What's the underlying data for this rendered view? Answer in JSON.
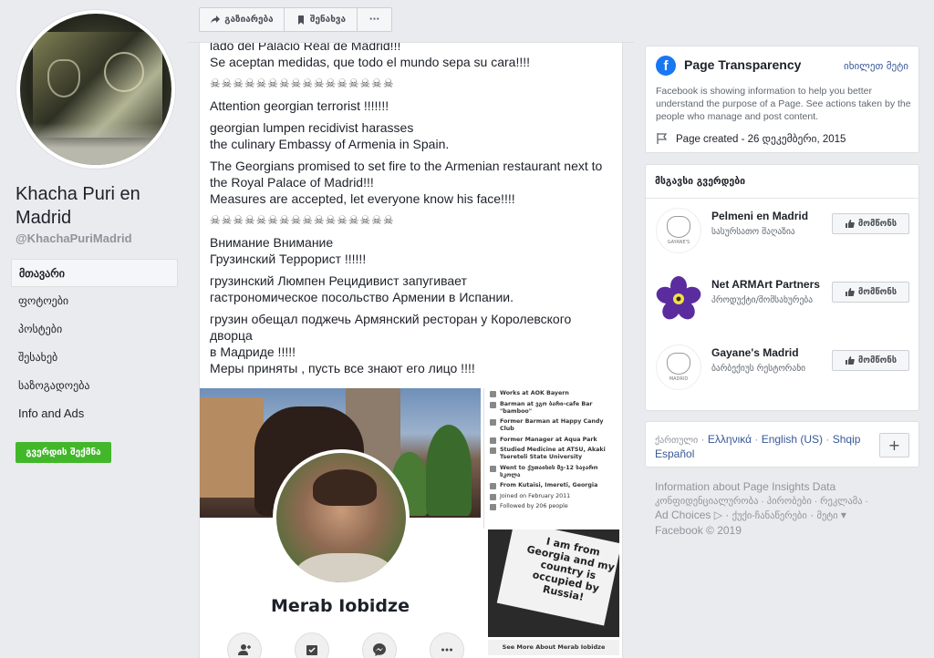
{
  "left": {
    "page_name": "Khacha Puri en Madrid",
    "page_handle": "@KhachaPuriMadrid",
    "nav": [
      "მთავარი",
      "ფოტოები",
      "პოსტები",
      "შესახებ",
      "საზოგადოება",
      "Info and Ads"
    ],
    "create_page_label": "გვერდის შექმნა"
  },
  "toolbar": {
    "share_label": "გაზიარება",
    "save_label": "შენახვა",
    "more_label": "···"
  },
  "post": {
    "paragraphs": [
      "lado del Palacio Real de Madrid!!!",
      "Se aceptan medidas, que todo el mundo sepa su cara!!!!",
      "☠☠☠☠☠☠☠☠☠☠☠☠☠☠☠☠",
      "Attention georgian terrorist !!!!!!!",
      "georgian lumpen recidivist harasses",
      "the culinary Embassy of Armenia in Spain.",
      "The Georgians promised to set fire to the Armenian restaurant next to",
      "the Royal Palace of Madrid!!!",
      "Measures are accepted, let everyone know his face!!!!",
      "☠☠☠☠☠☠☠☠☠☠☠☠☠☠☠☠",
      "Внимание Внимание",
      "Грузинский Террорист !!!!!!",
      "грузинский Люмпен Рецидивист запугивает",
      "гастрономическое посольство Армении в Испании.",
      "грузин обещал поджечь Армянский ресторан у Королевского дворца",
      "в Мадриде !!!!!",
      "Меры приняты , пусть все знают его лицо !!!!"
    ],
    "profile_name": "Merab Iobidze",
    "info": [
      "Works at AOK Bayern",
      "Barman at ეგო ბარი-cafe Bar \"bamboo\"",
      "Former Barman at Happy Candy Club",
      "Former Manager at Aqua Park",
      "Studied Medicine at ATSU, Akaki Tsereteli State University",
      "Went to ქუთაისის მე-12 საჯარო სკოლა",
      "From Kutaisi, Imereti, Georgia",
      "Joined on February 2011",
      "Followed by 206 people"
    ],
    "sign_text": "I am from Georgia and my country is occupied by Russia!",
    "see_more": "See More About Merab Iobidze"
  },
  "transparency": {
    "title": "Page Transparency",
    "see_more": "იხილეთ მეტი",
    "description": "Facebook is showing information to help you better understand the purpose of a Page. See actions taken by the people who manage and post content.",
    "created": "Page created - 26 დეკემბერი, 2015"
  },
  "similar": {
    "title": "მსგავსი გვერდები",
    "like_label": "მომწონს",
    "items": [
      {
        "name": "Pelmeni en Madrid",
        "category": "სასურსათო მაღაზია"
      },
      {
        "name": "Net ARMArt Partners",
        "category": "პროდუქტი/მომსახურება"
      },
      {
        "name": "Gayane's Madrid",
        "category": "ბარბექიუს რესტორანი"
      }
    ],
    "logo_text": "GAYANE'S",
    "logo_sub": "MADRID"
  },
  "languages": {
    "current": "ქართული",
    "others": [
      "Ελληνικά",
      "English (US)",
      "Shqip",
      "Español"
    ],
    "plus": "+"
  },
  "footer": {
    "line1": "Information about Page Insights Data",
    "links": [
      "კონფიდენციალურობა",
      "პირობები",
      "რეკლამა",
      "Ad Choices",
      "ქუქი-ჩანაწერები",
      "მეტი"
    ],
    "copyright": "Facebook © 2019"
  },
  "colors": {
    "link": "#385898",
    "green": "#42b72a",
    "fb_blue": "#1877f2"
  }
}
